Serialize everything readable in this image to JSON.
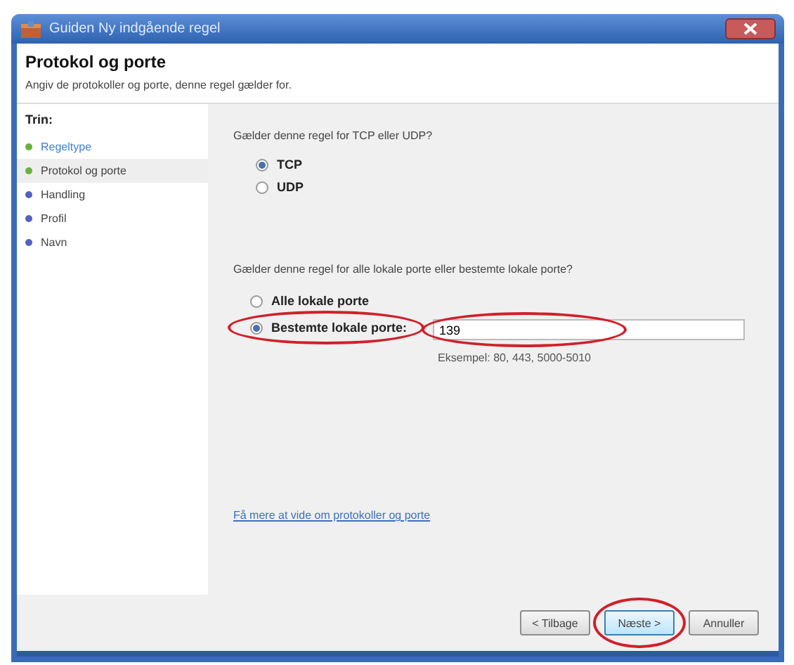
{
  "window": {
    "title": "Guiden Ny indgående regel"
  },
  "header": {
    "title": "Protokol og porte",
    "subtitle": "Angiv de protokoller og porte, denne regel gælder for."
  },
  "steps": {
    "label": "Trin:",
    "items": [
      {
        "label": "Regeltype",
        "done": true,
        "selected": false
      },
      {
        "label": "Protokol og porte",
        "done": true,
        "selected": true
      },
      {
        "label": "Handling",
        "done": false,
        "selected": false
      },
      {
        "label": "Profil",
        "done": false,
        "selected": false
      },
      {
        "label": "Navn",
        "done": false,
        "selected": false
      }
    ]
  },
  "protocol": {
    "question": "Gælder denne regel for TCP eller UDP?",
    "options": [
      {
        "label": "TCP",
        "selected": true
      },
      {
        "label": "UDP",
        "selected": false
      }
    ]
  },
  "ports": {
    "question": "Gælder denne regel for alle lokale porte eller bestemte lokale porte?",
    "options": [
      {
        "label": "Alle lokale porte",
        "selected": false,
        "highlighted": false
      },
      {
        "label": "Bestemte lokale porte:",
        "selected": true,
        "highlighted": true
      }
    ],
    "field": {
      "value": "139",
      "highlighted": true
    },
    "example": "Eksempel: 80, 443, 5000-5010"
  },
  "link": "Få mere at vide om protokoller og porte",
  "buttons": [
    {
      "label": "< Tilbage",
      "default": false,
      "highlighted": false
    },
    {
      "label": "Næste >",
      "default": true,
      "highlighted": true
    },
    {
      "label": "Annuller",
      "default": false,
      "highlighted": false
    }
  ]
}
